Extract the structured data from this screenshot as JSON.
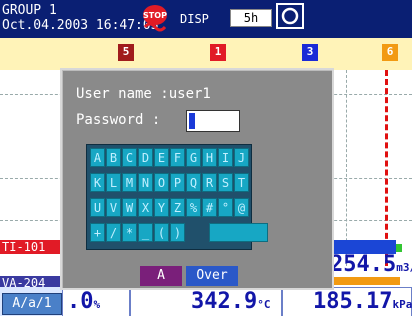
{
  "header": {
    "group": "GROUP 1",
    "datetime": "Oct.04.2003 16:47:03",
    "stop_icon": "stop-icon",
    "disp_label": "DISP",
    "span": "5h",
    "memory_icon": "memory-card-icon"
  },
  "markers": [
    {
      "label": "5",
      "color": "#a01c1c"
    },
    {
      "label": "1",
      "color": "#e11b26"
    },
    {
      "label": "3",
      "color": "#1b2ad6"
    },
    {
      "label": "6",
      "color": "#f29a12"
    }
  ],
  "channels": {
    "ch1": "TI-101",
    "ch2": "VA-204"
  },
  "readouts": {
    "r1_value": "254.5",
    "r1_unit": "m3/h",
    "r2_value": ".0",
    "r2_unit": "%",
    "r3_value": "342.9",
    "r3_unit": "°C",
    "r4_value": "185.17",
    "r4_unit": "kPa"
  },
  "mode": "A/a/1",
  "dialog": {
    "user_label": "User  name :user1",
    "password_label": "Password   :",
    "keys_row1": [
      "A",
      "B",
      "C",
      "D",
      "E",
      "F",
      "G",
      "H",
      "I",
      "J"
    ],
    "keys_row2": [
      "K",
      "L",
      "M",
      "N",
      "O",
      "P",
      "Q",
      "R",
      "S",
      "T"
    ],
    "keys_row3": [
      "U",
      "V",
      "W",
      "X",
      "Y",
      "Z",
      "%",
      "#",
      "°",
      "@"
    ],
    "keys_row4": [
      "+",
      "/",
      "*",
      "_",
      "(",
      ")"
    ],
    "btn_a": "A",
    "btn_over": "Over"
  },
  "colors": {
    "header_bg": "#0a1f73",
    "markbar_bg": "#fff3b8",
    "key_bg": "#17a7c4"
  }
}
